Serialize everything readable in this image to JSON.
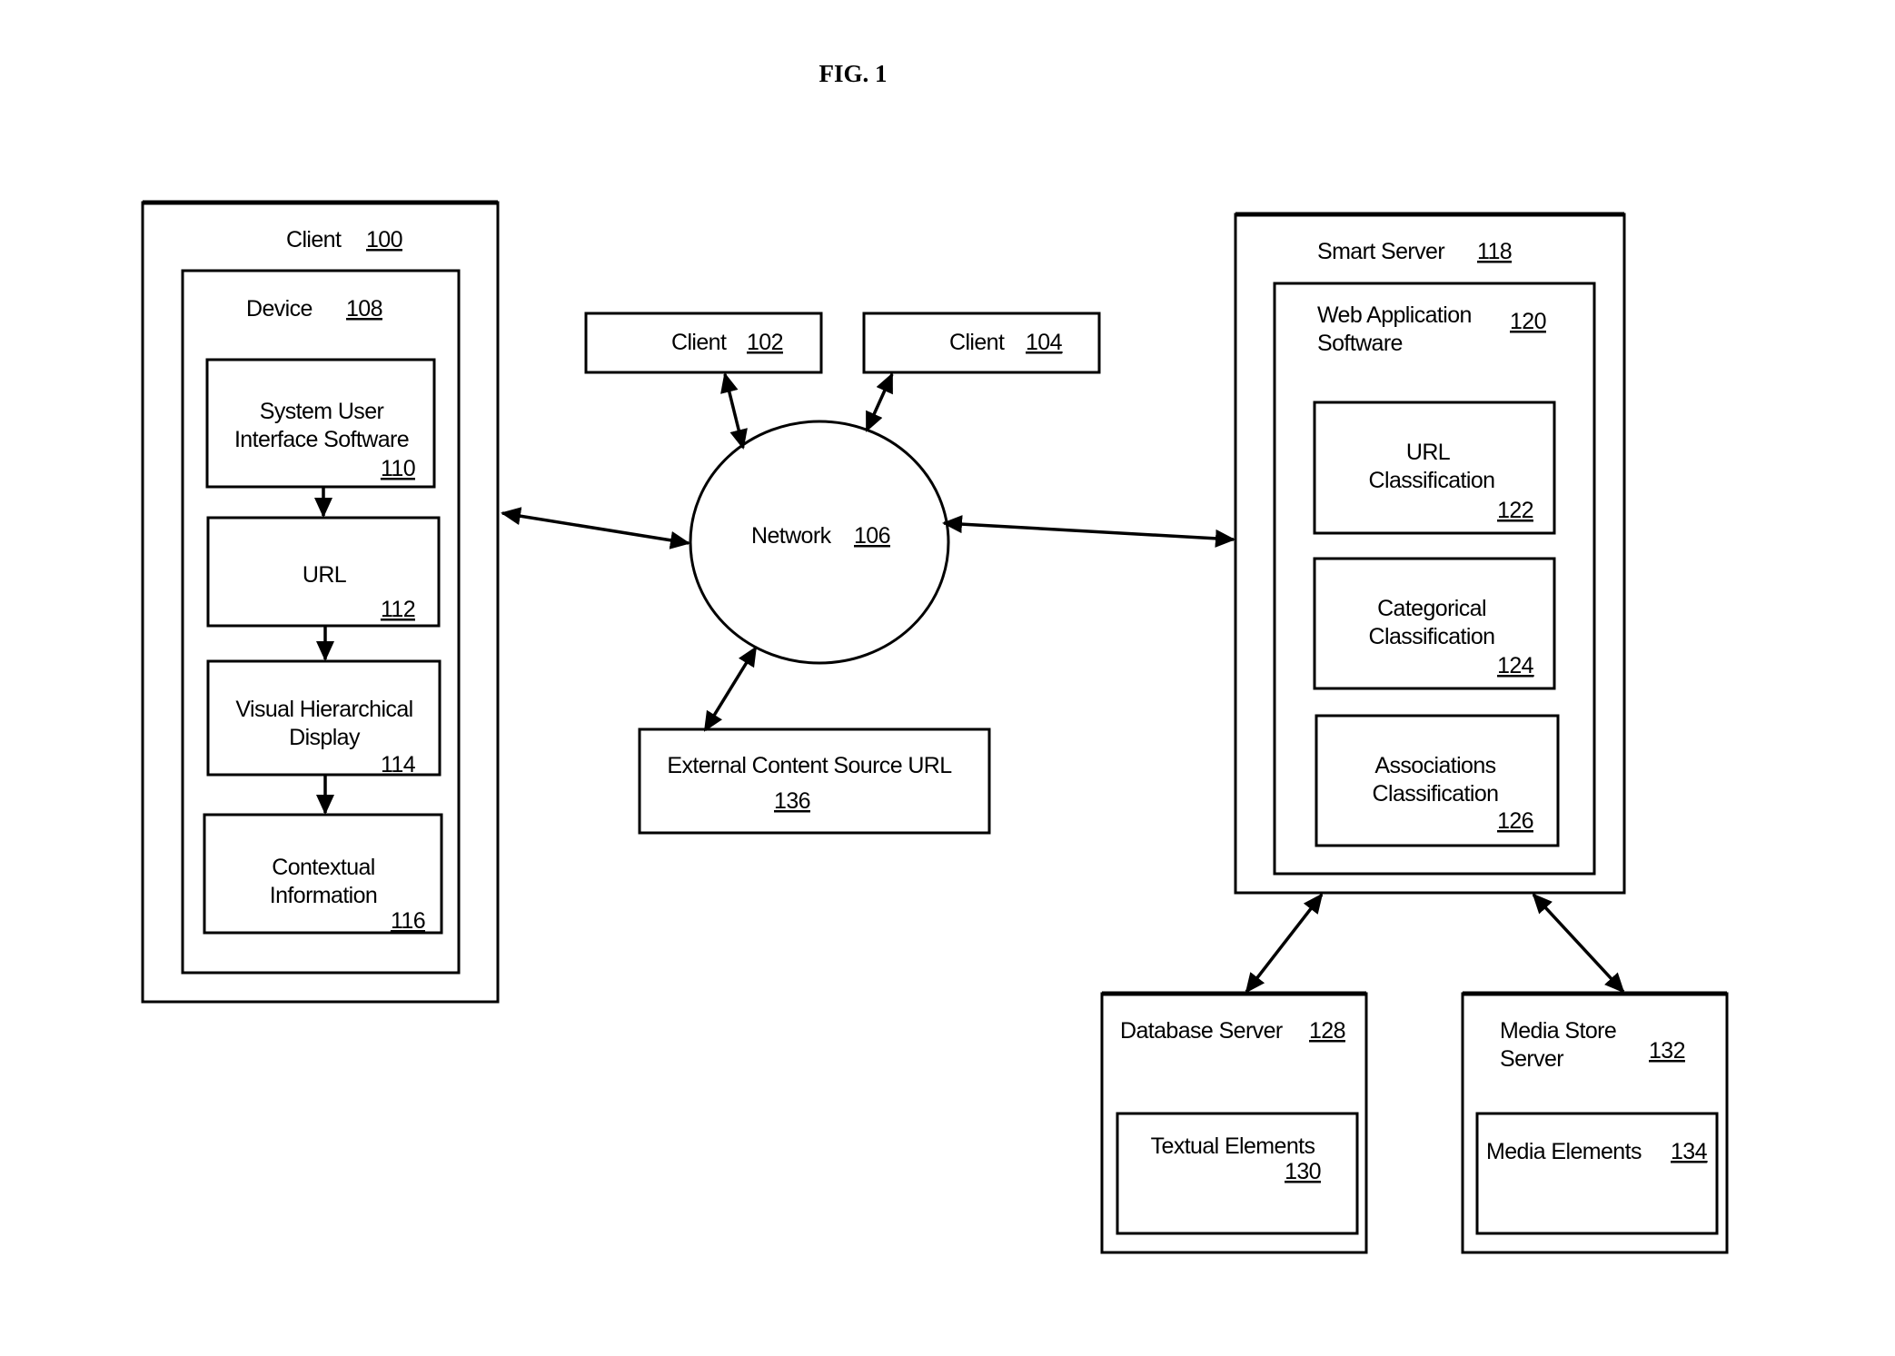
{
  "figure": {
    "title": "FIG. 1"
  },
  "nodes": {
    "client_100": {
      "label": "Client",
      "ref": "100"
    },
    "device_108": {
      "label": "Device",
      "ref": "108"
    },
    "sui_110": {
      "lines": [
        "System User",
        "Interface Software"
      ],
      "ref": "110"
    },
    "url_112": {
      "label": "URL",
      "ref": "112"
    },
    "vhd_114": {
      "lines": [
        "Visual Hierarchical",
        "Display"
      ],
      "ref": "114"
    },
    "ctx_116": {
      "lines": [
        "Contextual",
        "Information"
      ],
      "ref": "116"
    },
    "client_102": {
      "label": "Client",
      "ref": "102"
    },
    "client_104": {
      "label": "Client",
      "ref": "104"
    },
    "network_106": {
      "label": "Network",
      "ref": "106"
    },
    "ext_136": {
      "label": "External Content Source URL",
      "ref": "136"
    },
    "smart_118": {
      "label": "Smart Server",
      "ref": "118"
    },
    "webapp_120": {
      "lines": [
        "Web Application",
        "Software"
      ],
      "ref": "120"
    },
    "urlclass_122": {
      "lines": [
        "URL",
        "Classification"
      ],
      "ref": "122"
    },
    "catclass_124": {
      "lines": [
        "Categorical",
        "Classification"
      ],
      "ref": "124"
    },
    "assocclass_126": {
      "lines": [
        "Associations",
        "Classification"
      ],
      "ref": "126"
    },
    "db_128": {
      "label": "Database Server",
      "ref": "128"
    },
    "text_130": {
      "label": "Textual Elements",
      "ref": "130"
    },
    "media_132": {
      "lines": [
        "Media Store",
        "Server"
      ],
      "ref": "132"
    },
    "mediael_134": {
      "label": "Media Elements",
      "ref": "134"
    }
  },
  "connections": [
    {
      "from": "device_108.sui_110",
      "to": "url_112",
      "type": "one-way"
    },
    {
      "from": "url_112",
      "to": "vhd_114",
      "type": "one-way"
    },
    {
      "from": "vhd_114",
      "to": "ctx_116",
      "type": "one-way"
    },
    {
      "from": "client_100",
      "to": "network_106",
      "type": "bidirectional"
    },
    {
      "from": "client_102",
      "to": "network_106",
      "type": "bidirectional"
    },
    {
      "from": "client_104",
      "to": "network_106",
      "type": "bidirectional"
    },
    {
      "from": "ext_136",
      "to": "network_106",
      "type": "bidirectional"
    },
    {
      "from": "network_106",
      "to": "smart_118",
      "type": "bidirectional"
    },
    {
      "from": "smart_118",
      "to": "db_128",
      "type": "bidirectional"
    },
    {
      "from": "smart_118",
      "to": "media_132",
      "type": "bidirectional"
    }
  ]
}
